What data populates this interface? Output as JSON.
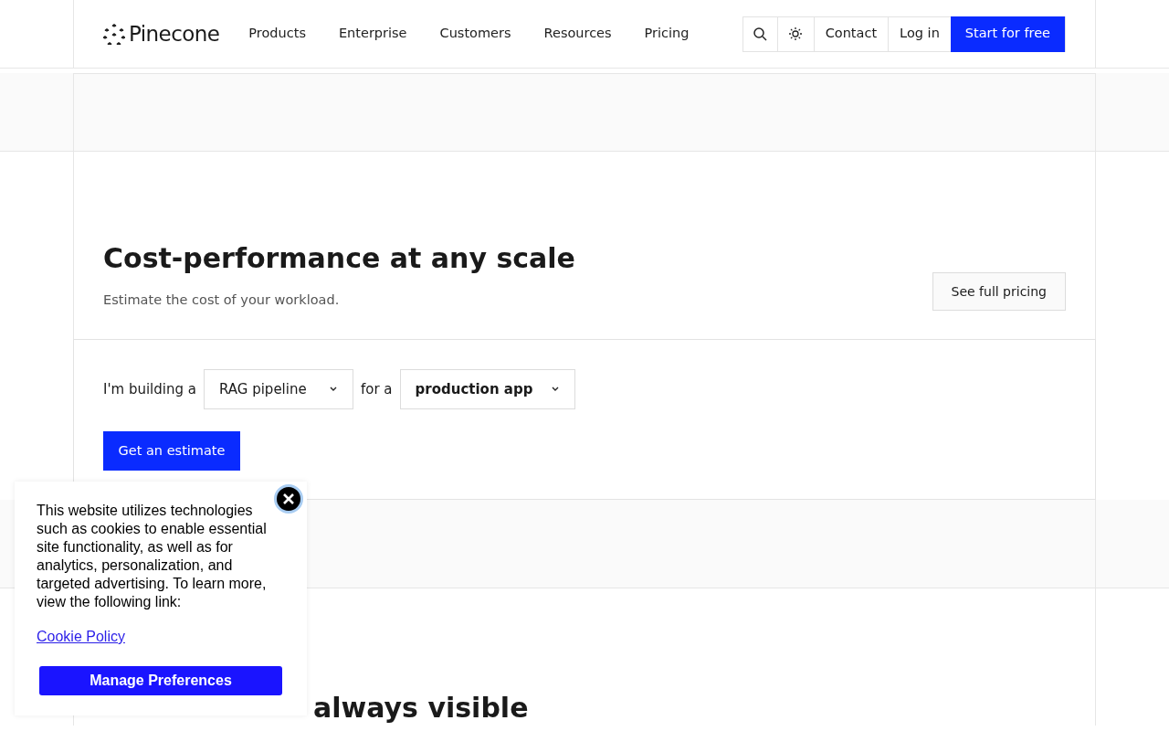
{
  "header": {
    "logo": "Pinecone",
    "nav": [
      "Products",
      "Enterprise",
      "Customers",
      "Resources",
      "Pricing"
    ],
    "contact": "Contact",
    "login": "Log in",
    "cta": "Start for free"
  },
  "pricing": {
    "title": "Cost-performance at any scale",
    "subtitle": "Estimate the cost of your workload.",
    "full_pricing": "See full pricing"
  },
  "estimator": {
    "lead": "I'm building a",
    "use_case": "RAG pipeline",
    "joiner": "for a",
    "stage": "production app",
    "button": "Get an estimate"
  },
  "next_section": {
    "title": "always visible"
  },
  "cookie_banner": {
    "text": "This website utilizes technologies such as cookies to enable essential site functionality, as well as for analytics, personalization, and targeted advertising. To learn more, view the following link:",
    "link": "Cookie Policy",
    "button": "Manage Preferences"
  }
}
